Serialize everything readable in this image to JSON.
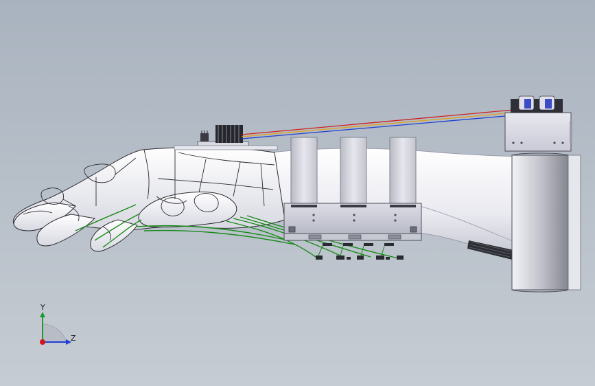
{
  "viewport": {
    "background_top": "#a9b3bf",
    "background_bottom": "#c6ccd3"
  },
  "model": {
    "parts": [
      "hand",
      "forearm",
      "wrist-straps",
      "actuator-bracket",
      "cable-guides",
      "tendon-cables",
      "control-board",
      "signal-wires",
      "battery-box",
      "forearm-cuff",
      "ribbon-connector"
    ],
    "tendon_color": "#1a8a1a",
    "wire_colors": [
      "#d11f1f",
      "#e0a020",
      "#1c3fd1"
    ]
  },
  "triad": {
    "y_label": "Y",
    "z_label": "Z",
    "y_color": "#1c9b2a",
    "z_color": "#1f3fd6",
    "origin_color": "#d01818"
  }
}
